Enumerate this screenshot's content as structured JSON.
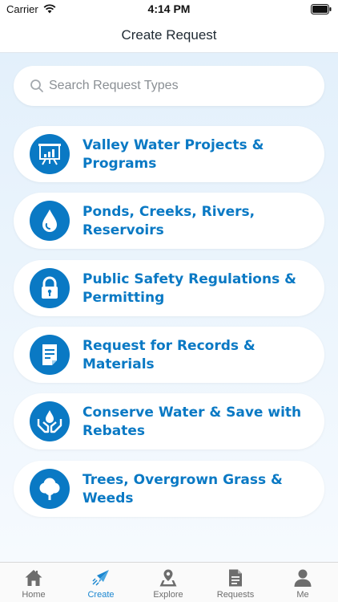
{
  "status": {
    "carrier": "Carrier",
    "time": "4:14 PM"
  },
  "nav": {
    "title": "Create Request"
  },
  "search": {
    "placeholder": "Search Request Types"
  },
  "items": [
    {
      "label": "Valley Water Projects & Programs",
      "icon": "presentation-chart-icon"
    },
    {
      "label": "Ponds, Creeks, Rivers, Reservoirs",
      "icon": "water-drop-icon"
    },
    {
      "label": "Public Safety Regulations & Permitting",
      "icon": "lock-icon"
    },
    {
      "label": "Request for Records & Materials",
      "icon": "document-icon"
    },
    {
      "label": "Conserve Water & Save with Rebates",
      "icon": "hands-drop-icon"
    },
    {
      "label": "Trees, Overgrown Grass & Weeds",
      "icon": "tree-icon"
    }
  ],
  "tabs": [
    {
      "label": "Home",
      "icon": "home-icon",
      "active": false
    },
    {
      "label": "Create",
      "icon": "paper-plane-icon",
      "active": true
    },
    {
      "label": "Explore",
      "icon": "map-pin-icon",
      "active": false
    },
    {
      "label": "Requests",
      "icon": "document-list-icon",
      "active": false
    },
    {
      "label": "Me",
      "icon": "user-icon",
      "active": false
    }
  ],
  "colors": {
    "accent": "#0a79c4",
    "tab_active": "#1a86d0",
    "tab_inactive": "#6d6d6d"
  }
}
